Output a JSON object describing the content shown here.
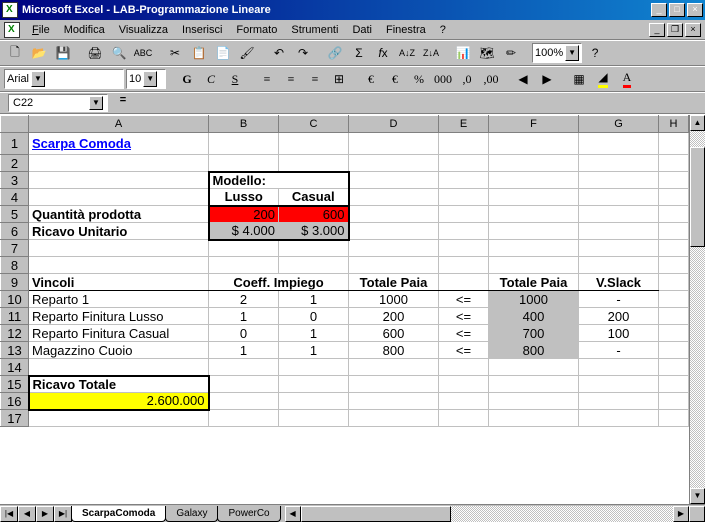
{
  "window": {
    "title": "Microsoft Excel - LAB-Programmazione Lineare"
  },
  "menu": {
    "file": "File",
    "modifica": "Modifica",
    "visualizza": "Visualizza",
    "inserisci": "Inserisci",
    "formato": "Formato",
    "strumenti": "Strumenti",
    "dati": "Dati",
    "finestra": "Finestra",
    "help": "?"
  },
  "format": {
    "font": "Arial",
    "size": "10",
    "zoom": "100%"
  },
  "namebox": {
    "cell": "C22",
    "fx": "="
  },
  "columns": [
    "A",
    "B",
    "C",
    "D",
    "E",
    "F",
    "G",
    "H"
  ],
  "rows": [
    "1",
    "2",
    "3",
    "4",
    "5",
    "6",
    "7",
    "8",
    "9",
    "10",
    "11",
    "12",
    "13",
    "14",
    "15",
    "16",
    "17"
  ],
  "cells": {
    "A1": "Scarpa Comoda",
    "B3": "Modello:",
    "B4": "Lusso",
    "C4": "Casual",
    "A5": "Quantità prodotta",
    "B5": "200",
    "C5": "600",
    "A6": "Ricavo Unitario",
    "B6": "$    4.000",
    "C6": "$   3.000",
    "A9": "Vincoli",
    "B9": "Coeff. Impiego",
    "D9": "Totale Paia",
    "F9": "Totale Paia",
    "G9": "V.Slack",
    "A10": "Reparto 1",
    "B10": "2",
    "C10": "1",
    "D10": "1000",
    "E10": "<=",
    "F10": "1000",
    "G10": "-",
    "A11": "Reparto Finitura Lusso",
    "B11": "1",
    "C11": "0",
    "D11": "200",
    "E11": "<=",
    "F11": "400",
    "G11": "200",
    "A12": "Reparto Finitura Casual",
    "B12": "0",
    "C12": "1",
    "D12": "600",
    "E12": "<=",
    "F12": "700",
    "G12": "100",
    "A13": "Magazzino Cuoio",
    "B13": "1",
    "C13": "1",
    "D13": "800",
    "E13": "<=",
    "F13": "800",
    "G13": "-",
    "A15": "Ricavo Totale",
    "A16": "2.600.000"
  },
  "tabs": {
    "active": "ScarpaComoda",
    "t2": "Galaxy",
    "t3": "PowerCo"
  }
}
